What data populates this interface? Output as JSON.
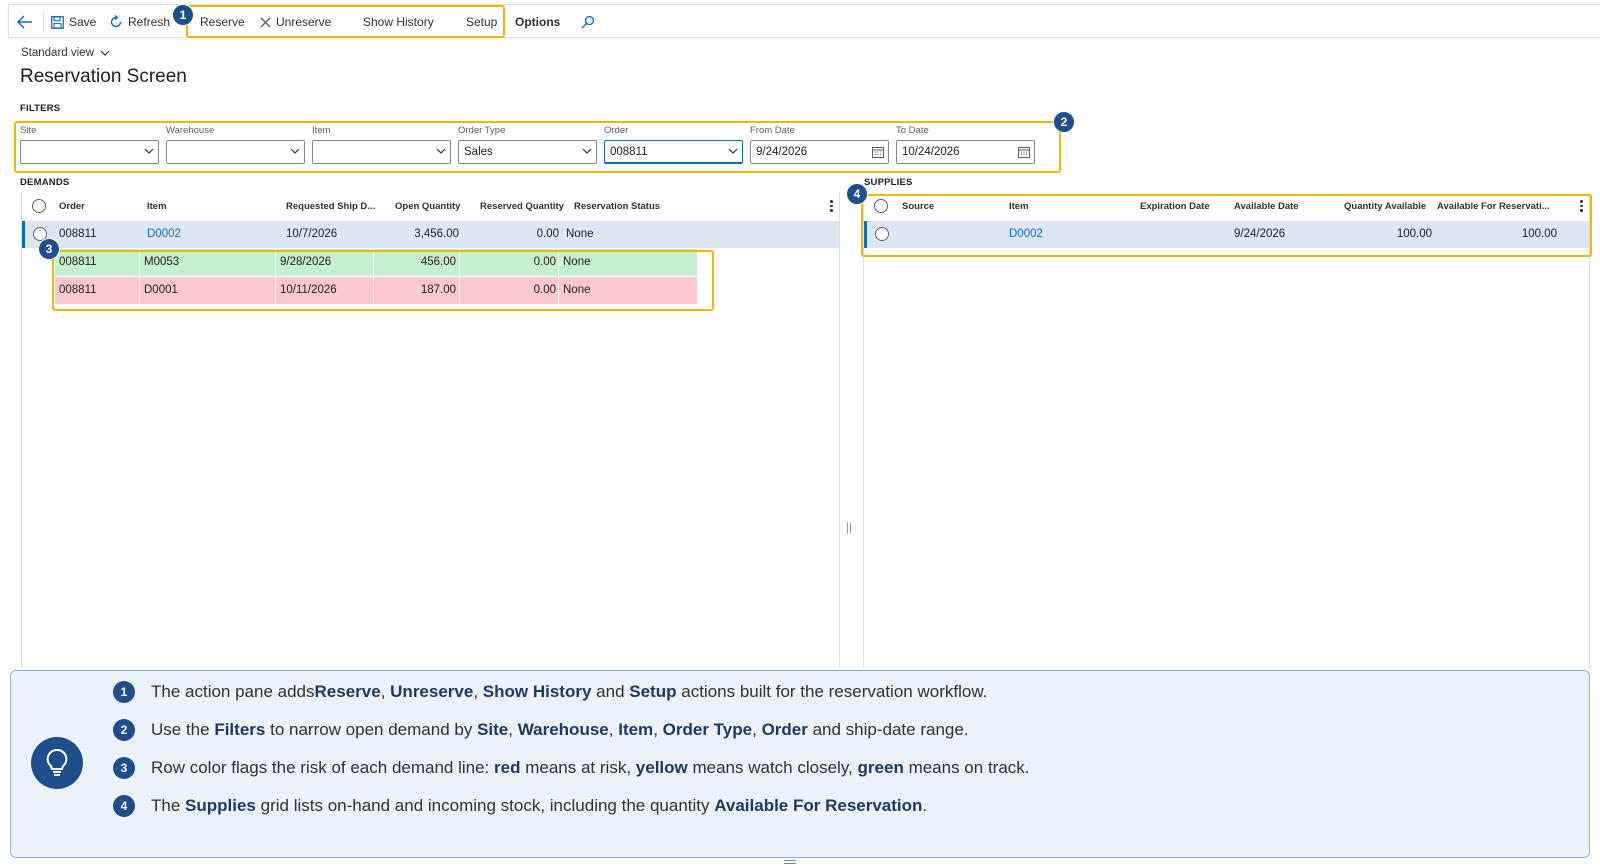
{
  "toolbar": {
    "save_label": "Save",
    "refresh_label": "Refresh",
    "reserve_label": "Reserve",
    "unreserve_label": "Unreserve",
    "show_history_label": "Show History",
    "setup_label": "Setup",
    "options_label": "Options",
    "icons": [
      "back-arrow-icon",
      "save-icon",
      "refresh-icon",
      "close-icon",
      "search-icon"
    ]
  },
  "callouts": [
    "1",
    "2",
    "3",
    "4"
  ],
  "page": {
    "view_label": "Standard view",
    "title": "Reservation Screen"
  },
  "filters": {
    "section_label": "FILTERS",
    "site": {
      "label": "Site",
      "value": ""
    },
    "warehouse": {
      "label": "Warehouse",
      "value": ""
    },
    "item": {
      "label": "Item",
      "value": ""
    },
    "order_type": {
      "label": "Order Type",
      "value": "Sales"
    },
    "order": {
      "label": "Order",
      "value": "008811"
    },
    "from_date": {
      "label": "From Date",
      "value": "9/24/2026"
    },
    "to_date": {
      "label": "To Date",
      "value": "10/24/2026"
    }
  },
  "demands": {
    "section_label": "DEMANDS",
    "columns": [
      "Order",
      "Item",
      "Requested Ship D...",
      "Open Quantity",
      "Reserved Quantity",
      "Reservation Status"
    ],
    "rows": [
      {
        "order": "008811",
        "item": "D0002",
        "ship_date": "10/7/2026",
        "open_qty": "3,456.00",
        "reserved_qty": "0.00",
        "status": "None",
        "risk": "selected"
      },
      {
        "order": "008811",
        "item": "M0053",
        "ship_date": "9/28/2026",
        "open_qty": "456.00",
        "reserved_qty": "0.00",
        "status": "None",
        "risk": "on-track"
      },
      {
        "order": "008811",
        "item": "D0001",
        "ship_date": "10/11/2026",
        "open_qty": "187.00",
        "reserved_qty": "0.00",
        "status": "None",
        "risk": "at-risk"
      }
    ]
  },
  "supplies": {
    "section_label": "SUPPLIES",
    "columns": [
      "Source",
      "Item",
      "Expiration Date",
      "Available Date",
      "Quantity Available",
      "Available For Reservati..."
    ],
    "rows": [
      {
        "source": "",
        "item": "D0002",
        "expiration_date": "",
        "available_date": "9/24/2026",
        "qty_available": "100.00",
        "available_for_reservation": "100.00"
      }
    ]
  },
  "notes": [
    {
      "num": "1",
      "parts": [
        "The action pane adds ",
        "Reserve",
        ", ",
        "Unreserve",
        ", ",
        "Show History",
        " and ",
        "Setup",
        " actions built for the reservation workflow."
      ]
    },
    {
      "num": "2",
      "parts": [
        "Use the ",
        "Filters",
        " to narrow open demand by ",
        "Site",
        ", ",
        "Warehouse",
        ", ",
        "Item",
        ", ",
        "Order Type",
        ", ",
        "Order",
        " and ship-date range."
      ]
    },
    {
      "num": "3",
      "parts": [
        "Row color flags the risk of each demand line: ",
        "red",
        " means at risk, ",
        "yellow",
        " means watch closely, ",
        "green",
        " means on track."
      ]
    },
    {
      "num": "4",
      "parts": [
        "The ",
        "Supplies",
        " grid lists on-hand and incoming stock, including the quantity ",
        "Available For Reservation",
        "."
      ]
    }
  ],
  "colors": {
    "accent": "#0f6cbd",
    "highlight": "#f2b705",
    "badge": "#1f4e8c",
    "row_selected": "#dce6f4",
    "row_green": "#c6efce",
    "row_red": "#ffc7ce"
  }
}
